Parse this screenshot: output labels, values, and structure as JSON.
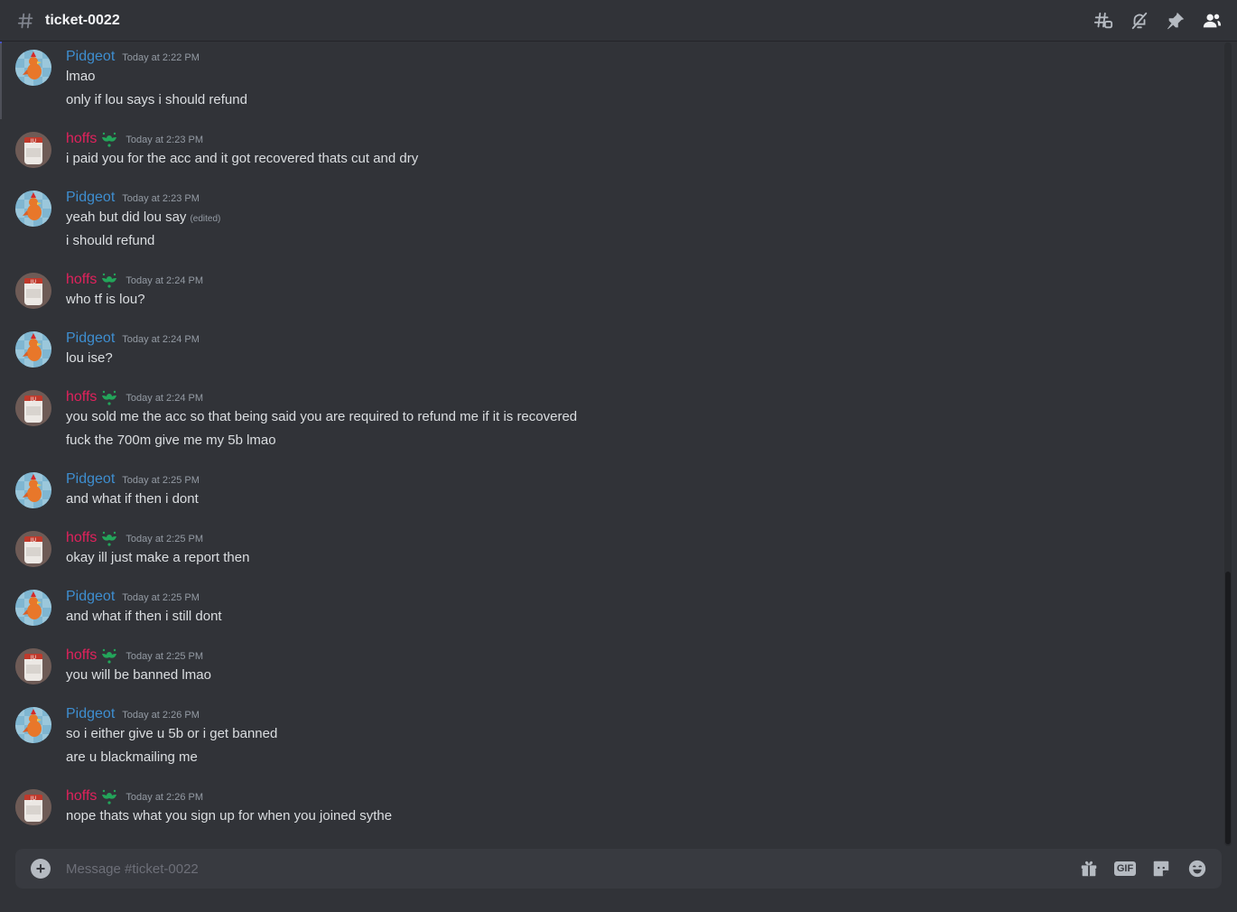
{
  "header": {
    "channel": "ticket-0022"
  },
  "composer": {
    "placeholder": "Message #ticket-0022"
  },
  "users": {
    "pidgeot": {
      "name": "Pidgeot",
      "color": "#3e8ed0"
    },
    "hoffs": {
      "name": "hoffs",
      "color": "#e0225c"
    }
  },
  "messages": [
    {
      "author": "Pidgeot",
      "time": "Today at 2:22 PM",
      "lines": [
        "lmao",
        "only if lou says i should refund"
      ]
    },
    {
      "author": "hoffs",
      "time": "Today at 2:23 PM",
      "lines": [
        "i paid you for the acc and it got recovered thats cut and dry"
      ]
    },
    {
      "author": "Pidgeot",
      "time": "Today at 2:23 PM",
      "lines": [
        "yeah but did lou say",
        "i should refund"
      ],
      "edited": "(edited)"
    },
    {
      "author": "hoffs",
      "time": "Today at 2:24 PM",
      "lines": [
        "who tf is lou?"
      ]
    },
    {
      "author": "Pidgeot",
      "time": "Today at 2:24 PM",
      "lines": [
        "lou ise?"
      ]
    },
    {
      "author": "hoffs",
      "time": "Today at 2:24 PM",
      "lines": [
        "you sold me the acc so that being said you are required to refund me if it is recovered",
        "fuck the 700m give me my 5b lmao"
      ]
    },
    {
      "author": "Pidgeot",
      "time": "Today at 2:25 PM",
      "lines": [
        "and what if then i dont"
      ]
    },
    {
      "author": "hoffs",
      "time": "Today at 2:25 PM",
      "lines": [
        "okay ill just make a report then"
      ]
    },
    {
      "author": "Pidgeot",
      "time": "Today at 2:25 PM",
      "lines": [
        "and what if then i still dont"
      ]
    },
    {
      "author": "hoffs",
      "time": "Today at 2:25 PM",
      "lines": [
        "you will be banned lmao"
      ]
    },
    {
      "author": "Pidgeot",
      "time": "Today at 2:26 PM",
      "lines": [
        "so i either give u 5b or i get banned",
        "are u blackmailing me"
      ]
    },
    {
      "author": "hoffs",
      "time": "Today at 2:26 PM",
      "lines": [
        "nope thats what you sign up for when you joined sythe"
      ]
    }
  ]
}
